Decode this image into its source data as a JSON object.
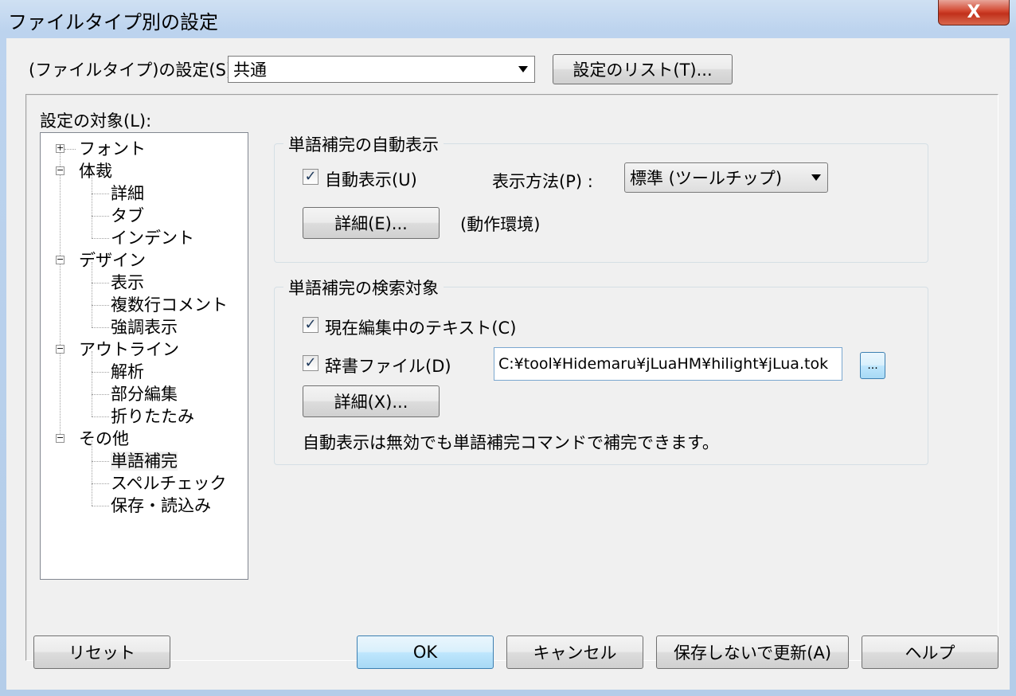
{
  "window": {
    "title": "ファイルタイプ別の設定",
    "close_glyph": "X"
  },
  "filetype": {
    "label": "(ファイルタイプ)の設定(S) :",
    "selected": "共通",
    "list_button": "設定のリスト(T)..."
  },
  "tree": {
    "label": "設定の対象(L):",
    "items": [
      {
        "label": "フォント",
        "expander": "+"
      },
      {
        "label": "体裁",
        "expander": "−"
      },
      {
        "label": "詳細"
      },
      {
        "label": "タブ"
      },
      {
        "label": "インデント"
      },
      {
        "label": "デザイン",
        "expander": "−"
      },
      {
        "label": "表示"
      },
      {
        "label": "複数行コメント"
      },
      {
        "label": "強調表示"
      },
      {
        "label": "アウトライン",
        "expander": "−"
      },
      {
        "label": "解析"
      },
      {
        "label": "部分編集"
      },
      {
        "label": "折りたたみ"
      },
      {
        "label": "その他",
        "expander": "−"
      },
      {
        "label": "単語補完"
      },
      {
        "label": "スペルチェック"
      },
      {
        "label": "保存・読込み"
      }
    ]
  },
  "auto_display_group": {
    "title": "単語補完の自動表示",
    "auto_checkbox_label": "自動表示(U)",
    "auto_checked": "✓",
    "method_label": "表示方法(P) :",
    "method_selected": "標準 (ツールチップ)",
    "detail_button": "詳細(E)...",
    "env_note": "(動作環境)"
  },
  "search_group": {
    "title": "単語補完の検索対象",
    "current_text_label": "現在編集中のテキスト(C)",
    "current_checked": "✓",
    "dict_label": "辞書ファイル(D)",
    "dict_checked": "✓",
    "dict_path": "C:¥tool¥Hidemaru¥jLuaHM¥hilight¥jLua.tok",
    "browse_button": "...",
    "detail_button": "詳細(X)...",
    "note": "自動表示は無効でも単語補完コマンドで補完できます。"
  },
  "footer": {
    "reset": "リセット",
    "ok": "OK",
    "cancel": "キャンセル",
    "update_nosave": "保存しないで更新(A)",
    "help": "ヘルプ"
  }
}
